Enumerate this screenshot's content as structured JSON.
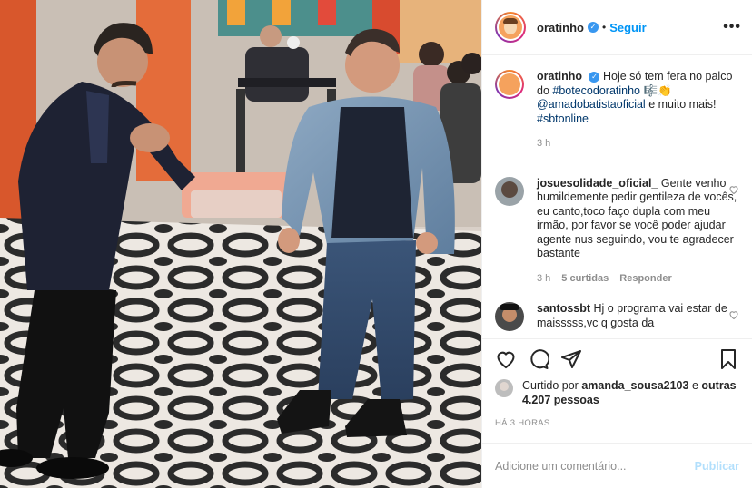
{
  "header": {
    "username": "oratinho",
    "dot": "•",
    "follow_label": "Seguir",
    "more_icon": "more-horizontal-icon"
  },
  "caption": {
    "username": "oratinho",
    "text_1": "Hoje só tem fera no palco do",
    "hashtag_1": "#botecodoratinho",
    "emojis": "🎼👏",
    "mention": "@amadobatistaoficial",
    "text_2": "e muito mais!",
    "hashtag_2": "#sbtonline",
    "time": "3 h"
  },
  "comments": [
    {
      "username": "josuesolidade_oficial_",
      "text": "Gente venho humildemente pedir gentileza de vocês, eu canto,toco faço dupla com meu irmão, por favor se você poder ajudar agente nus seguindo, vou te agradecer bastante",
      "time": "3 h",
      "likes": "5 curtidas",
      "reply": "Responder"
    },
    {
      "username": "santossbt",
      "text": "Hj o programa vai estar de maisssss,vc q gosta da"
    }
  ],
  "likes": {
    "prefix": "Curtido por",
    "user": "amanda_sousa2103",
    "connector": "e",
    "others": "outras 4.207 pessoas"
  },
  "timestamp": "HÁ 3 HORAS",
  "add_comment": {
    "placeholder": "Adicione um comentário...",
    "publish_label": "Publicar"
  },
  "colors": {
    "link": "#00376b",
    "follow": "#0095f6",
    "publish_disabled": "#b2dffc",
    "muted": "#8e8e8e"
  }
}
